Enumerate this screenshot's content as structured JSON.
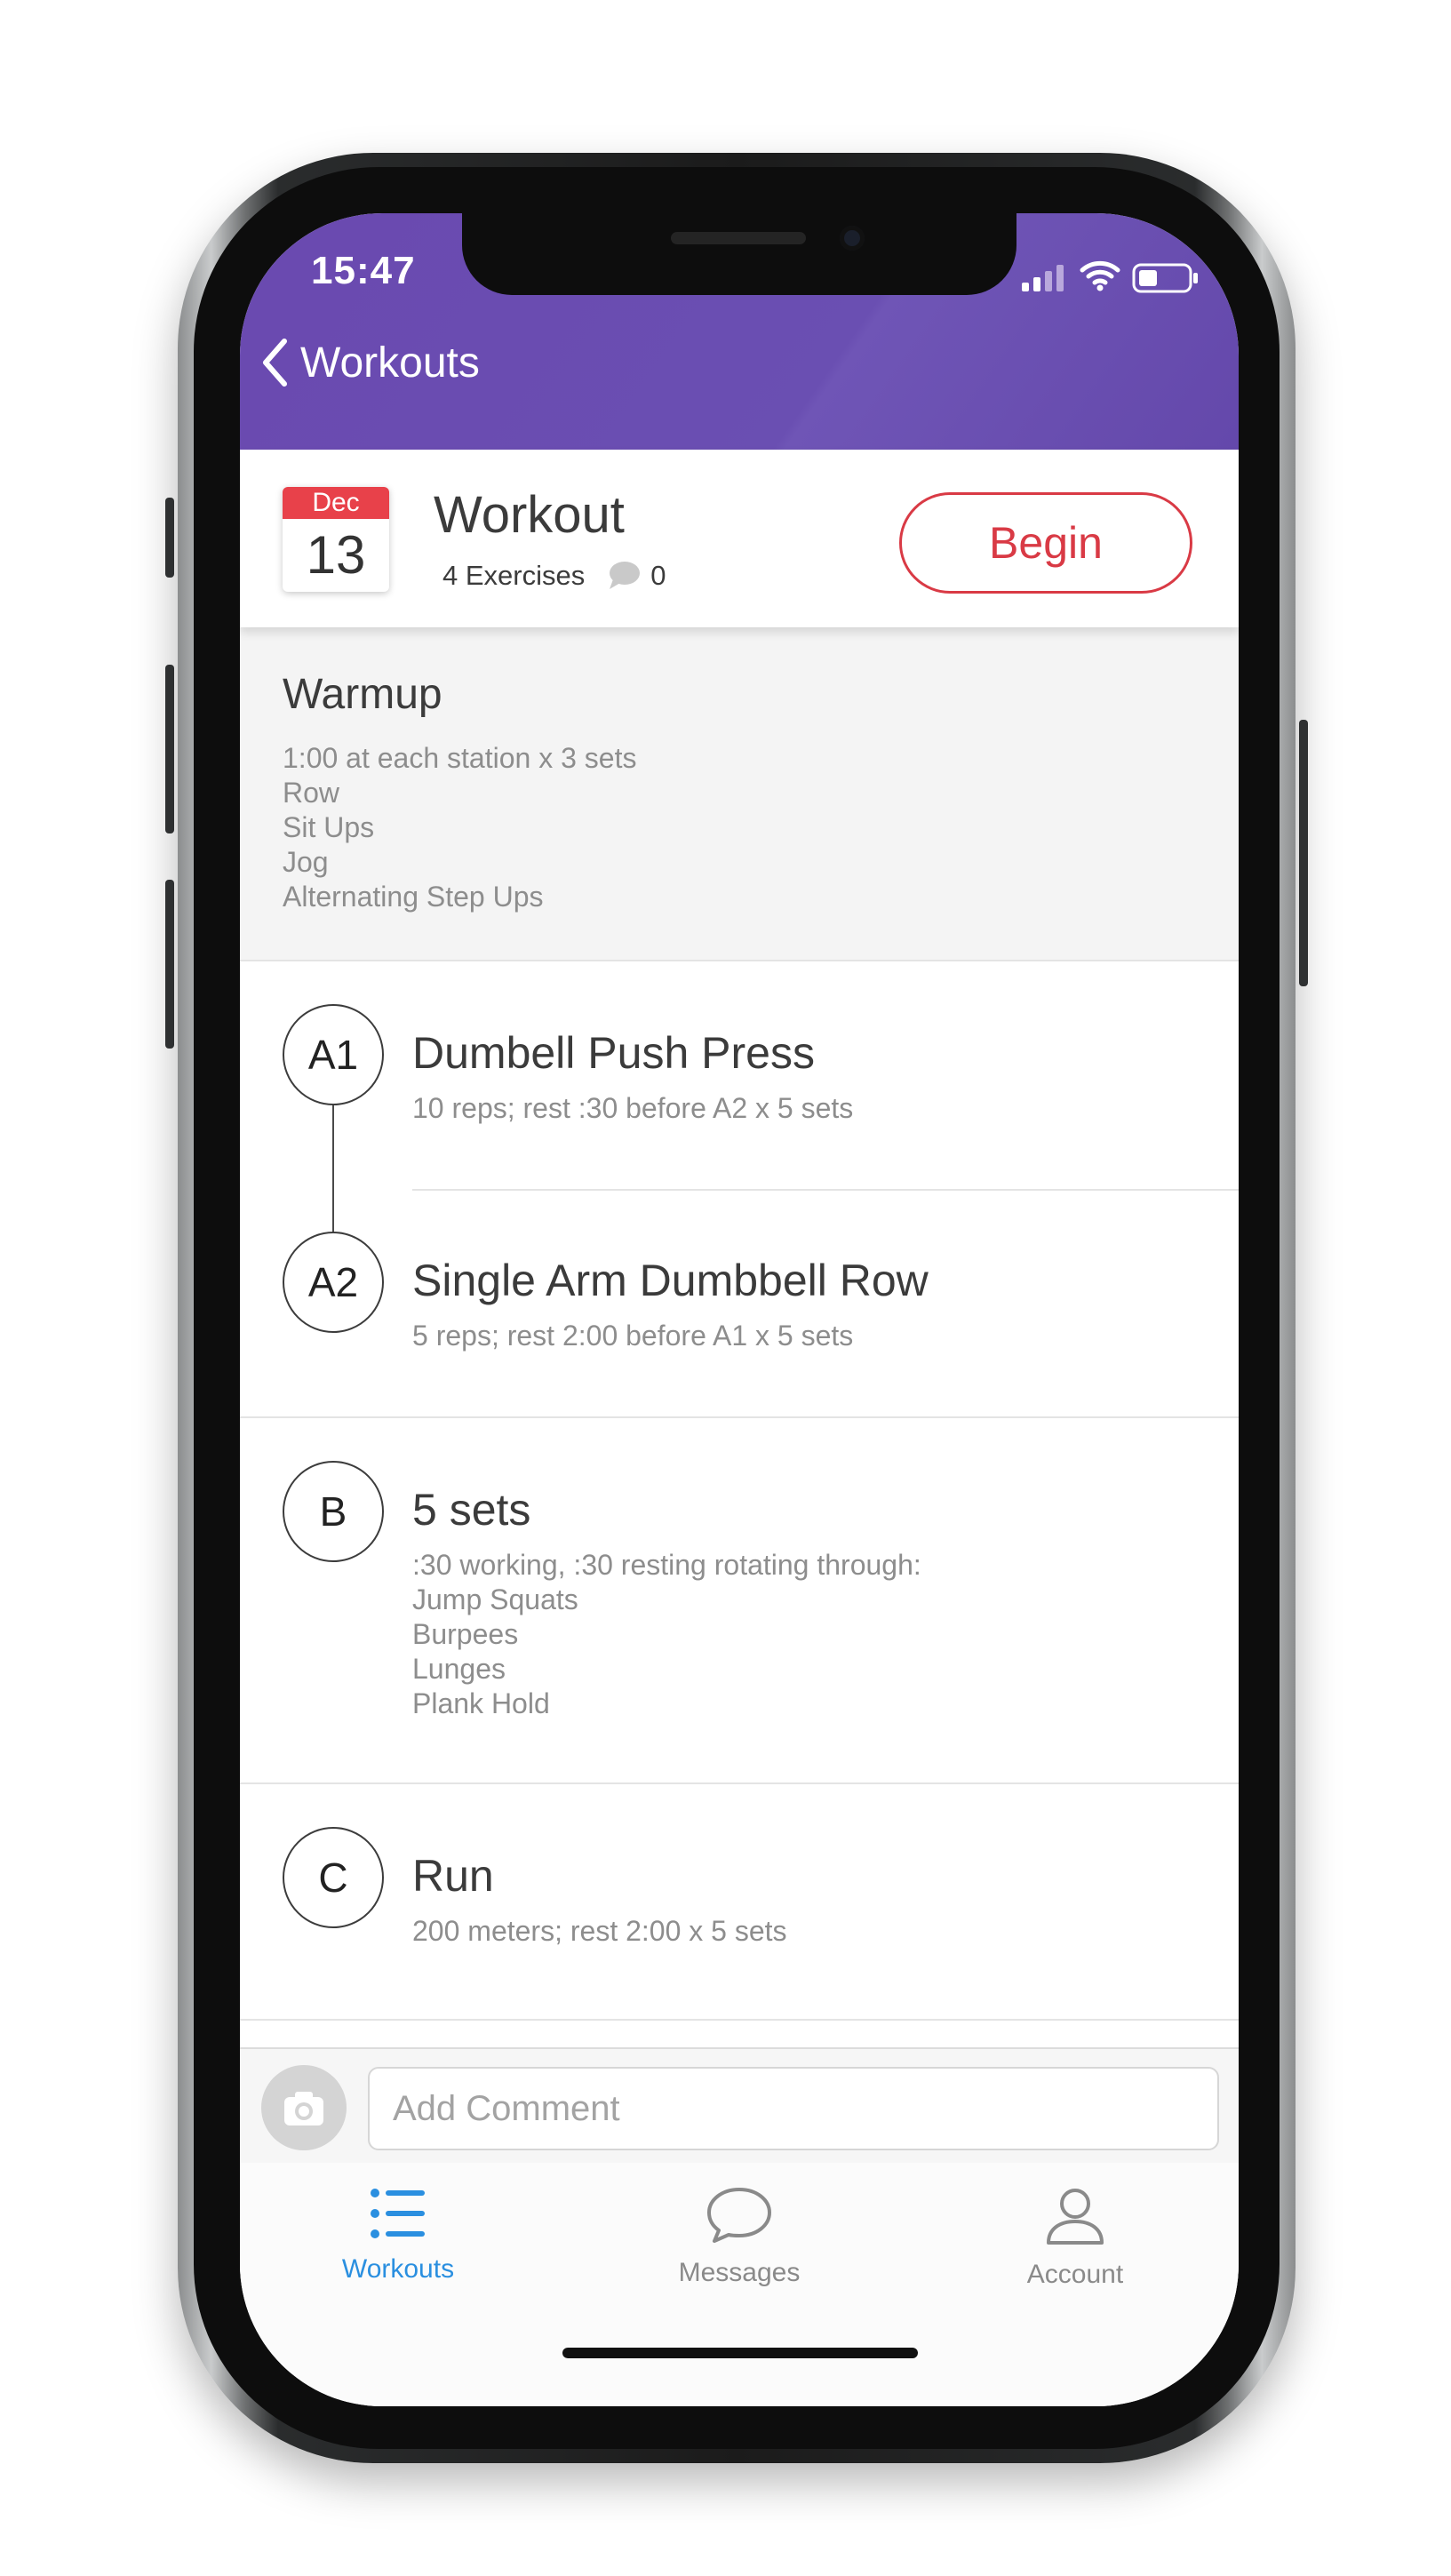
{
  "status_bar": {
    "time": "15:47"
  },
  "header": {
    "back_label": "Workouts"
  },
  "summary": {
    "date_month": "Dec",
    "date_day": "13",
    "title": "Workout",
    "exercise_count": "4 Exercises",
    "comment_count": "0",
    "begin_label": "Begin"
  },
  "warmup": {
    "title": "Warmup",
    "lines": [
      "1:00 at each station x 3 sets",
      "Row",
      "Sit Ups",
      "Jog",
      "Alternating Step Ups"
    ]
  },
  "exercises": [
    {
      "badge": "A1",
      "title": "Dumbell Push Press",
      "details": [
        "10 reps; rest :30 before A2 x 5 sets"
      ]
    },
    {
      "badge": "A2",
      "title": "Single Arm Dumbbell Row",
      "details": [
        "5 reps; rest 2:00 before A1 x 5 sets"
      ]
    },
    {
      "badge": "B",
      "title": "5 sets",
      "details": [
        ":30 working, :30 resting rotating through:",
        "Jump Squats",
        "Burpees",
        "Lunges",
        "Plank Hold"
      ]
    },
    {
      "badge": "C",
      "title": "Run",
      "details": [
        "200 meters; rest 2:00 x 5 sets"
      ]
    }
  ],
  "comment": {
    "placeholder": "Add Comment"
  },
  "tabs": [
    {
      "label": "Workouts",
      "icon": "list-icon",
      "active": true
    },
    {
      "label": "Messages",
      "icon": "chat-bubble-icon",
      "active": false
    },
    {
      "label": "Account",
      "icon": "person-icon",
      "active": false
    }
  ],
  "colors": {
    "header_purple": "#6a49b0",
    "accent_red": "#d93a45",
    "tab_active_blue": "#2a8fe0",
    "tab_inactive_gray": "#8a8a8a"
  }
}
